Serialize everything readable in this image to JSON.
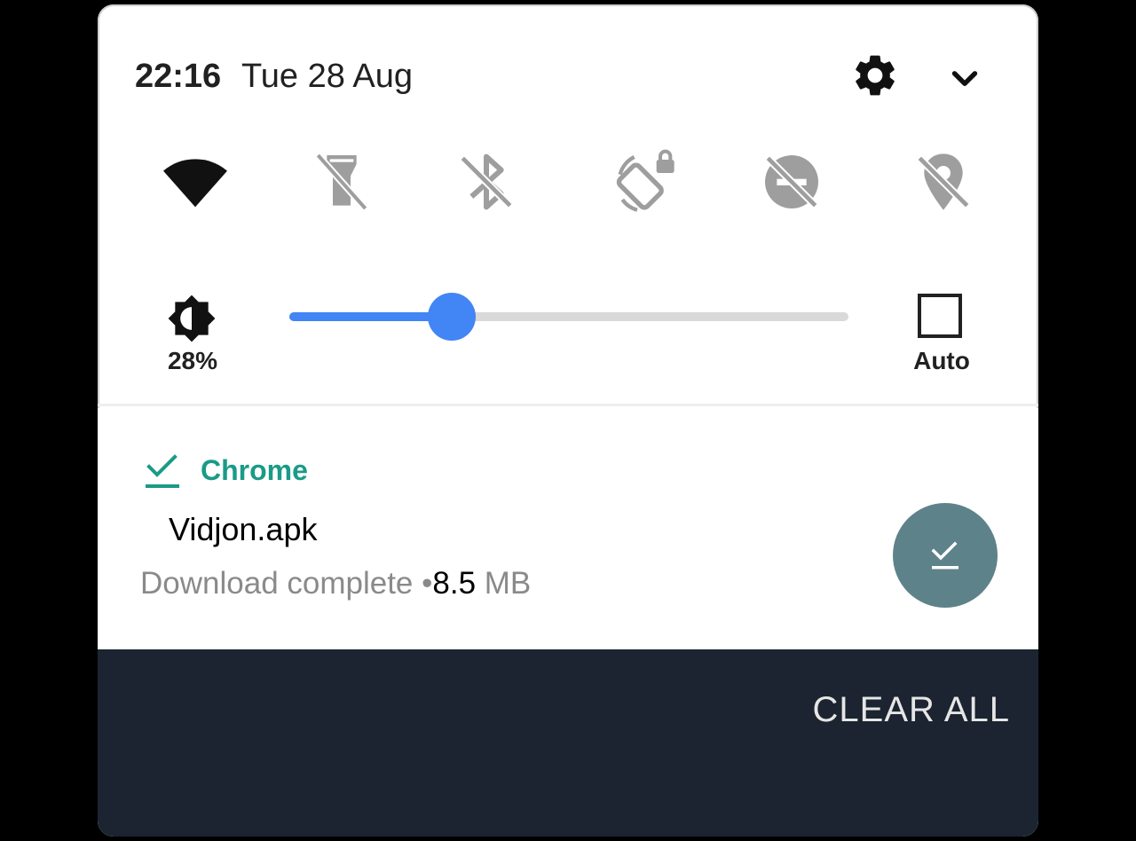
{
  "status": {
    "time": "22:16",
    "date": "Tue 28 Aug"
  },
  "icons": {
    "settings": "gear-icon",
    "expand": "chevron-down-icon"
  },
  "tiles": [
    {
      "name": "wifi",
      "icon": "wifi-icon",
      "active": true
    },
    {
      "name": "flashlight",
      "icon": "flashlight-off-icon",
      "active": false
    },
    {
      "name": "bluetooth",
      "icon": "bluetooth-off-icon",
      "active": false
    },
    {
      "name": "auto-rotate",
      "icon": "rotation-lock-icon",
      "active": false
    },
    {
      "name": "data-saver",
      "icon": "data-saver-off-icon",
      "active": false
    },
    {
      "name": "location",
      "icon": "location-off-icon",
      "active": false
    }
  ],
  "brightness": {
    "value_label": "28%",
    "level": 0.29,
    "auto_label": "Auto",
    "auto_checked": false
  },
  "notification": {
    "app_name": "Chrome",
    "title": "Vidjon.apk",
    "status_text": "Download complete •",
    "size_number": "8.5",
    "size_unit": " MB"
  },
  "actions": {
    "clear_all": "CLEAR ALL"
  },
  "colors": {
    "accent_blue": "#4285f4",
    "chrome_green": "#1a9b87",
    "action_button": "#5e8289",
    "bottom_bar": "#1b2430"
  }
}
